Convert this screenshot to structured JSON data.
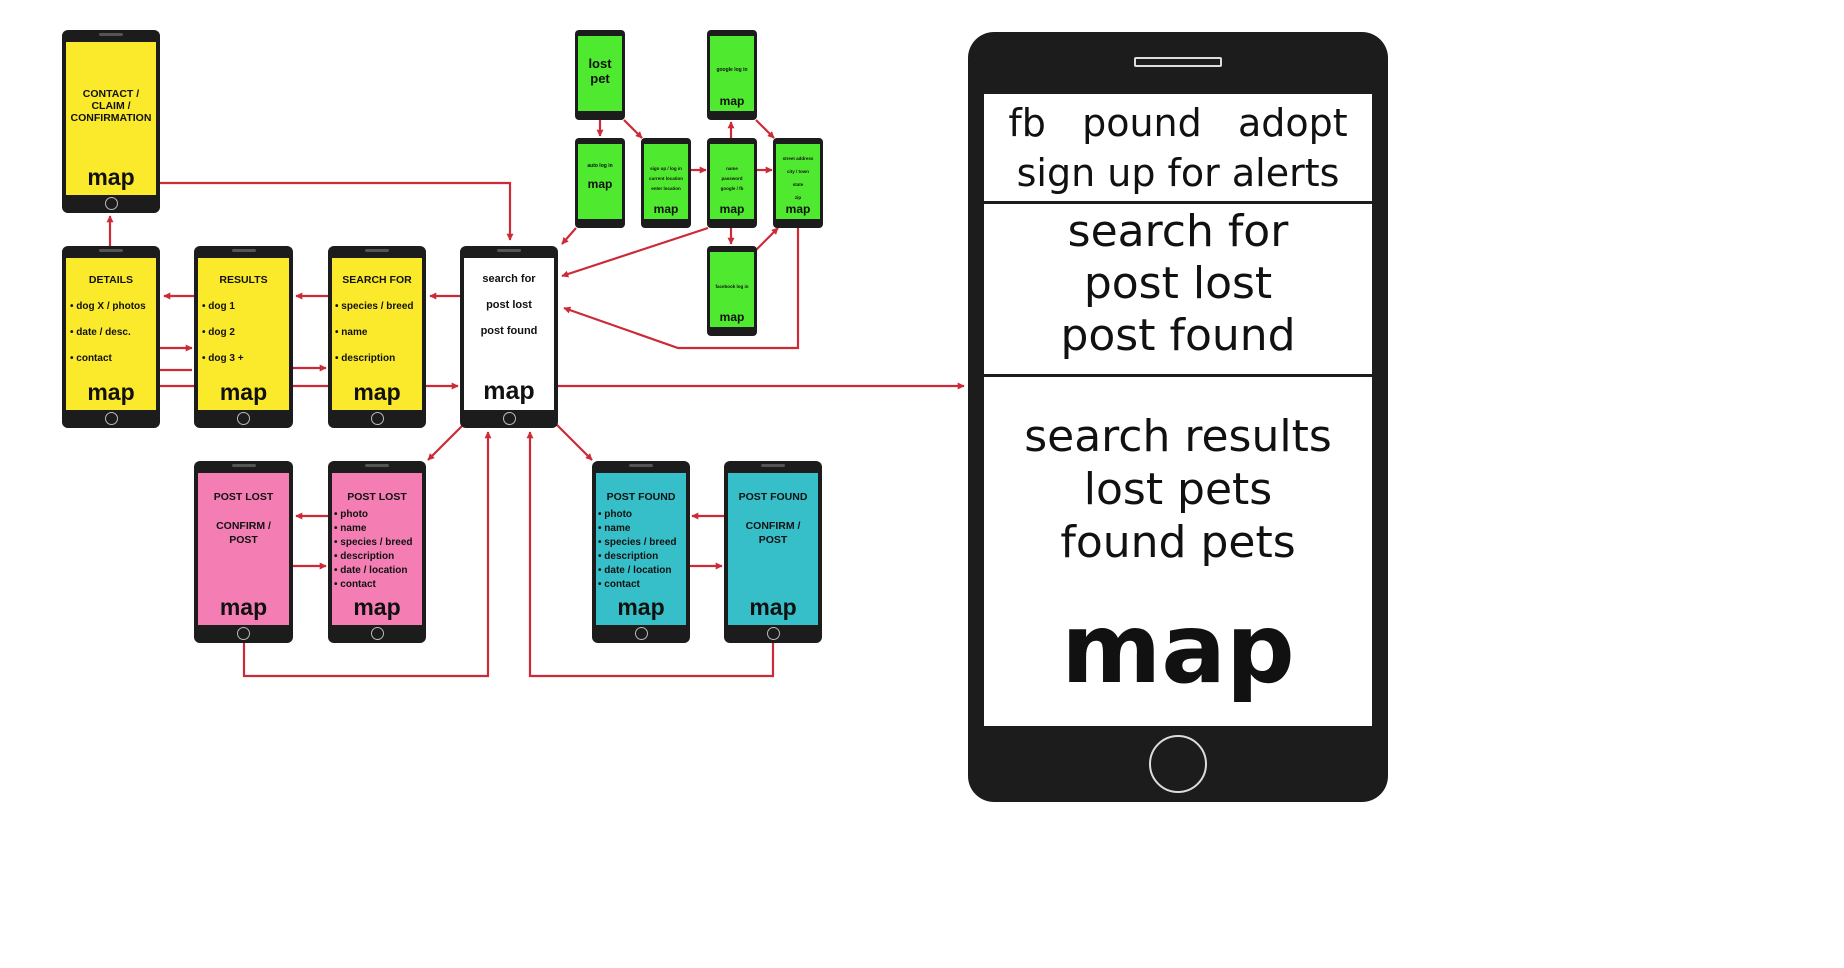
{
  "colors": {
    "yellow": "#fbe92b",
    "green": "#4fe92f",
    "pink": "#f47eb3",
    "cyan": "#36bfc8",
    "white": "#ffffff",
    "arrow": "#cc2a36",
    "phone_body": "#1c1c1c"
  },
  "phones": {
    "contact": {
      "lines": [
        "CONTACT /",
        "CLAIM /",
        "CONFIRMATION"
      ],
      "map": "map"
    },
    "details": {
      "title": "DETAILS",
      "lines": [
        "• dog X / photos",
        "• date / desc.",
        "• contact"
      ],
      "map": "map"
    },
    "results": {
      "title": "RESULTS",
      "lines": [
        "• dog 1",
        "• dog 2",
        "• dog 3 +"
      ],
      "map": "map"
    },
    "search": {
      "title": "SEARCH FOR",
      "lines": [
        "• species / breed",
        "• name",
        "• description"
      ],
      "map": "map"
    },
    "home": {
      "lines": [
        "search for",
        "post lost",
        "post found"
      ],
      "map": "map"
    },
    "post_lost_confirm": {
      "title": "POST LOST",
      "lines": [
        "CONFIRM /",
        "POST"
      ],
      "map": "map"
    },
    "post_lost_form": {
      "title": "POST LOST",
      "lines": [
        "• photo",
        "• name",
        "• species / breed",
        "• description",
        "• date / location",
        "• contact"
      ],
      "map": "map"
    },
    "post_found_form": {
      "title": "POST FOUND",
      "lines": [
        "• photo",
        "• name",
        "• species / breed",
        "• description",
        "• date / location",
        "• contact"
      ],
      "map": "map"
    },
    "post_found_confirm": {
      "title": "POST FOUND",
      "lines": [
        "CONFIRM /",
        "POST"
      ],
      "map": "map"
    },
    "lost_pet": {
      "lines": [
        "lost",
        "pet"
      ]
    },
    "google_login": {
      "lines": [
        "google log in"
      ],
      "map": "map"
    },
    "auto_login": {
      "lines": [
        "auto log in"
      ],
      "map": "map"
    },
    "signup": {
      "lines": [
        "sign up / log in",
        "current location",
        "enter location"
      ],
      "map": "map"
    },
    "name_pw": {
      "lines": [
        "name",
        "password",
        "google / fb"
      ],
      "map": "map"
    },
    "address": {
      "lines": [
        "street address",
        "city / town",
        "state",
        "zip"
      ],
      "map": "map"
    },
    "facebook_login": {
      "lines": [
        "facebook log in"
      ],
      "map": "map"
    }
  },
  "big_phone": {
    "top": [
      "fb   pound   adopt",
      "sign up for alerts"
    ],
    "middle": [
      "search for",
      "post lost",
      "post found"
    ],
    "bottom": [
      "search results",
      "lost pets",
      "found pets"
    ],
    "map": "map"
  }
}
